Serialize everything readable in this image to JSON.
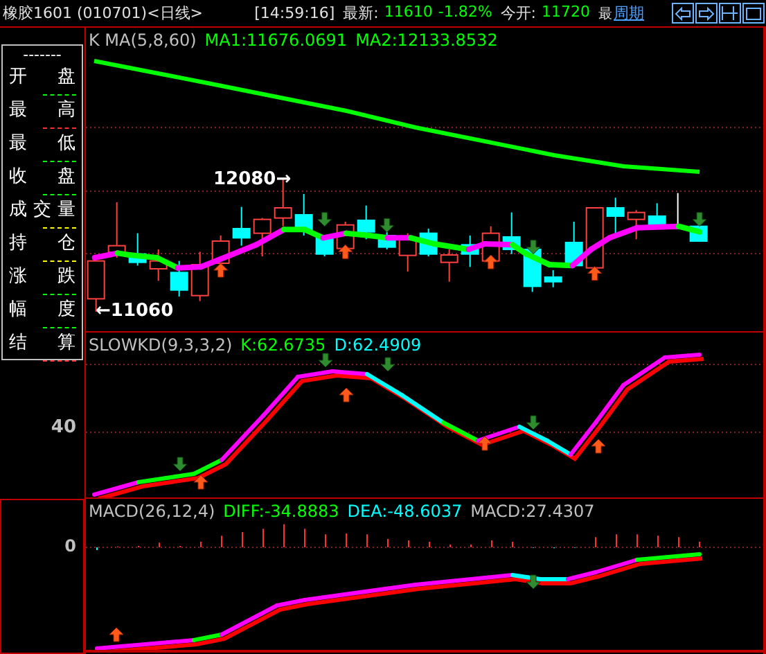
{
  "header": {
    "title": "橡胶1601 (010701)<日线>",
    "time": "[14:59:16]",
    "fields": [
      {
        "label": "最新:",
        "values": [
          "11610",
          "-1.82%"
        ]
      },
      {
        "label": "今开:",
        "values": [
          "11720"
        ]
      }
    ],
    "cut_label": "最",
    "period_link": "周期"
  },
  "toolbar_buttons": [
    {
      "kind": "left"
    },
    {
      "kind": "right"
    },
    {
      "kind": "split"
    },
    {
      "kind": "window"
    }
  ],
  "legend": {
    "dashes": "-------",
    "items": [
      {
        "label": "开 盘",
        "color": "#00ff00"
      },
      {
        "label": "最 高",
        "color": "#ff3030"
      },
      {
        "label": "最 低",
        "color": "#00ff00"
      },
      {
        "label": "收 盘",
        "color": "#00ff00"
      },
      {
        "label": "成交量",
        "color": "#ffff00"
      },
      {
        "label": "持 仓",
        "color": "#ffff00"
      },
      {
        "label": "涨 跌",
        "color": "#00ff00"
      },
      {
        "label": "幅 度",
        "color": "#00ff00"
      },
      {
        "label": "结 算",
        "color": "#ff3030"
      }
    ]
  },
  "axis": {
    "kd_tick": "40",
    "macd_tick": "0"
  },
  "price_panel": {
    "indicator": "K  MA(5,8,60)",
    "values": [
      {
        "text": "MA1:11676.0691",
        "color": "#00ff00"
      },
      {
        "text": "MA2:12133.8532",
        "color": "#00ff00"
      }
    ],
    "high_label": "12080→",
    "low_label": "←11060"
  },
  "kd_panel": {
    "indicator": "SLOWKD(9,3,3,2)",
    "values": [
      {
        "text": "K:62.6735",
        "color": "#00ff00"
      },
      {
        "text": "D:62.4909",
        "color": "#00ffff"
      }
    ]
  },
  "macd_panel": {
    "indicator": "MACD(26,12,4)",
    "values": [
      {
        "text": "DIFF:-34.8883",
        "color": "#00ff00"
      },
      {
        "text": "DEA:-48.6037",
        "color": "#00ffff"
      },
      {
        "text": "MACD:27.4307",
        "color": "#c0c0c0"
      }
    ]
  }
}
